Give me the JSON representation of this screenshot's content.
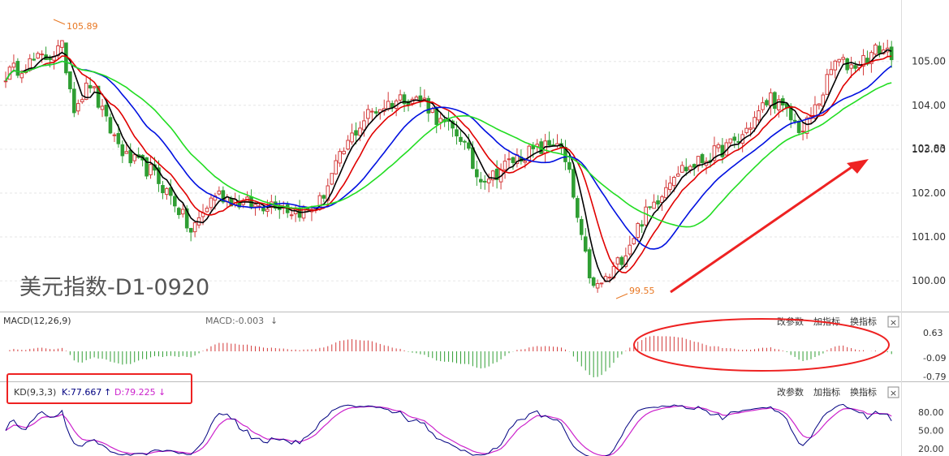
{
  "chart_data": {
    "type": "candlestick",
    "title": "美元指数-D1-0920",
    "price_axis": {
      "ylim": [
        99.3,
        106.4
      ],
      "ticks": [
        "100.00",
        "101.00",
        "102.00",
        "103.00",
        "104.00",
        "105.00"
      ],
      "current_price": "102.83",
      "high_label": "105.89",
      "low_label": "99.55"
    },
    "ma_colors": {
      "ma5": "#000000",
      "ma10": "#e00000",
      "ma20": "#0010e0",
      "ma30": "#22dd22"
    },
    "anchors": [
      {
        "x": 0,
        "y": 104.7
      },
      {
        "x": 4,
        "y": 104.9
      },
      {
        "x": 10,
        "y": 105.1
      },
      {
        "x": 14,
        "y": 105.3
      },
      {
        "x": 17,
        "y": 104.0
      },
      {
        "x": 21,
        "y": 104.5
      },
      {
        "x": 25,
        "y": 103.6
      },
      {
        "x": 30,
        "y": 102.8
      },
      {
        "x": 36,
        "y": 102.5
      },
      {
        "x": 42,
        "y": 101.8
      },
      {
        "x": 46,
        "y": 101.1
      },
      {
        "x": 52,
        "y": 102.0
      },
      {
        "x": 58,
        "y": 101.8
      },
      {
        "x": 62,
        "y": 101.7
      },
      {
        "x": 67,
        "y": 101.8
      },
      {
        "x": 71,
        "y": 101.6
      },
      {
        "x": 75,
        "y": 101.6
      },
      {
        "x": 78,
        "y": 101.8
      },
      {
        "x": 82,
        "y": 102.6
      },
      {
        "x": 86,
        "y": 103.3
      },
      {
        "x": 90,
        "y": 103.8
      },
      {
        "x": 94,
        "y": 104.0
      },
      {
        "x": 99,
        "y": 104.2
      },
      {
        "x": 104,
        "y": 104.1
      },
      {
        "x": 108,
        "y": 103.6
      },
      {
        "x": 113,
        "y": 103.3
      },
      {
        "x": 117,
        "y": 102.4
      },
      {
        "x": 121,
        "y": 102.4
      },
      {
        "x": 125,
        "y": 102.7
      },
      {
        "x": 129,
        "y": 102.9
      },
      {
        "x": 133,
        "y": 103.0
      },
      {
        "x": 137,
        "y": 103.2
      },
      {
        "x": 140,
        "y": 102.4
      },
      {
        "x": 143,
        "y": 100.9
      },
      {
        "x": 146,
        "y": 99.8
      },
      {
        "x": 150,
        "y": 100.1
      },
      {
        "x": 154,
        "y": 100.7
      },
      {
        "x": 158,
        "y": 101.4
      },
      {
        "x": 162,
        "y": 101.9
      },
      {
        "x": 166,
        "y": 102.5
      },
      {
        "x": 170,
        "y": 102.6
      },
      {
        "x": 174,
        "y": 102.8
      },
      {
        "x": 178,
        "y": 103.0
      },
      {
        "x": 182,
        "y": 103.2
      },
      {
        "x": 186,
        "y": 103.7
      },
      {
        "x": 190,
        "y": 104.2
      },
      {
        "x": 194,
        "y": 103.8
      },
      {
        "x": 198,
        "y": 103.4
      },
      {
        "x": 202,
        "y": 104.1
      },
      {
        "x": 206,
        "y": 105.0
      },
      {
        "x": 210,
        "y": 104.9
      },
      {
        "x": 214,
        "y": 105.1
      },
      {
        "x": 217,
        "y": 105.3
      },
      {
        "x": 220,
        "y": 105.2
      }
    ],
    "macd": {
      "label": "MACD(12,26,9)",
      "value_label": "MACD:-0.003",
      "value_arrow": "↓",
      "ticks": [
        "0.63",
        "-0.09",
        "-0.79"
      ],
      "ylim": [
        -0.79,
        0.63
      ]
    },
    "kd": {
      "label": "KD(9,3,3)",
      "k_label": "K:77.667",
      "k_arrow": "↑",
      "d_label": "D:79.225",
      "d_arrow": "↓",
      "ticks": [
        "80.00",
        "50.00",
        "20.00"
      ],
      "ylim": [
        15,
        100
      ],
      "k_color": "#000080",
      "d_color": "#cc22cc"
    },
    "annotations": {
      "arrow_color": "#ee2222",
      "ellipse_color": "#ee2222",
      "highlight_box_color": "#ee2222"
    }
  },
  "panel_buttons": {
    "change_params": "改参数",
    "add_indicator": "加指标",
    "switch_indicator": "换指标",
    "close": "×"
  }
}
